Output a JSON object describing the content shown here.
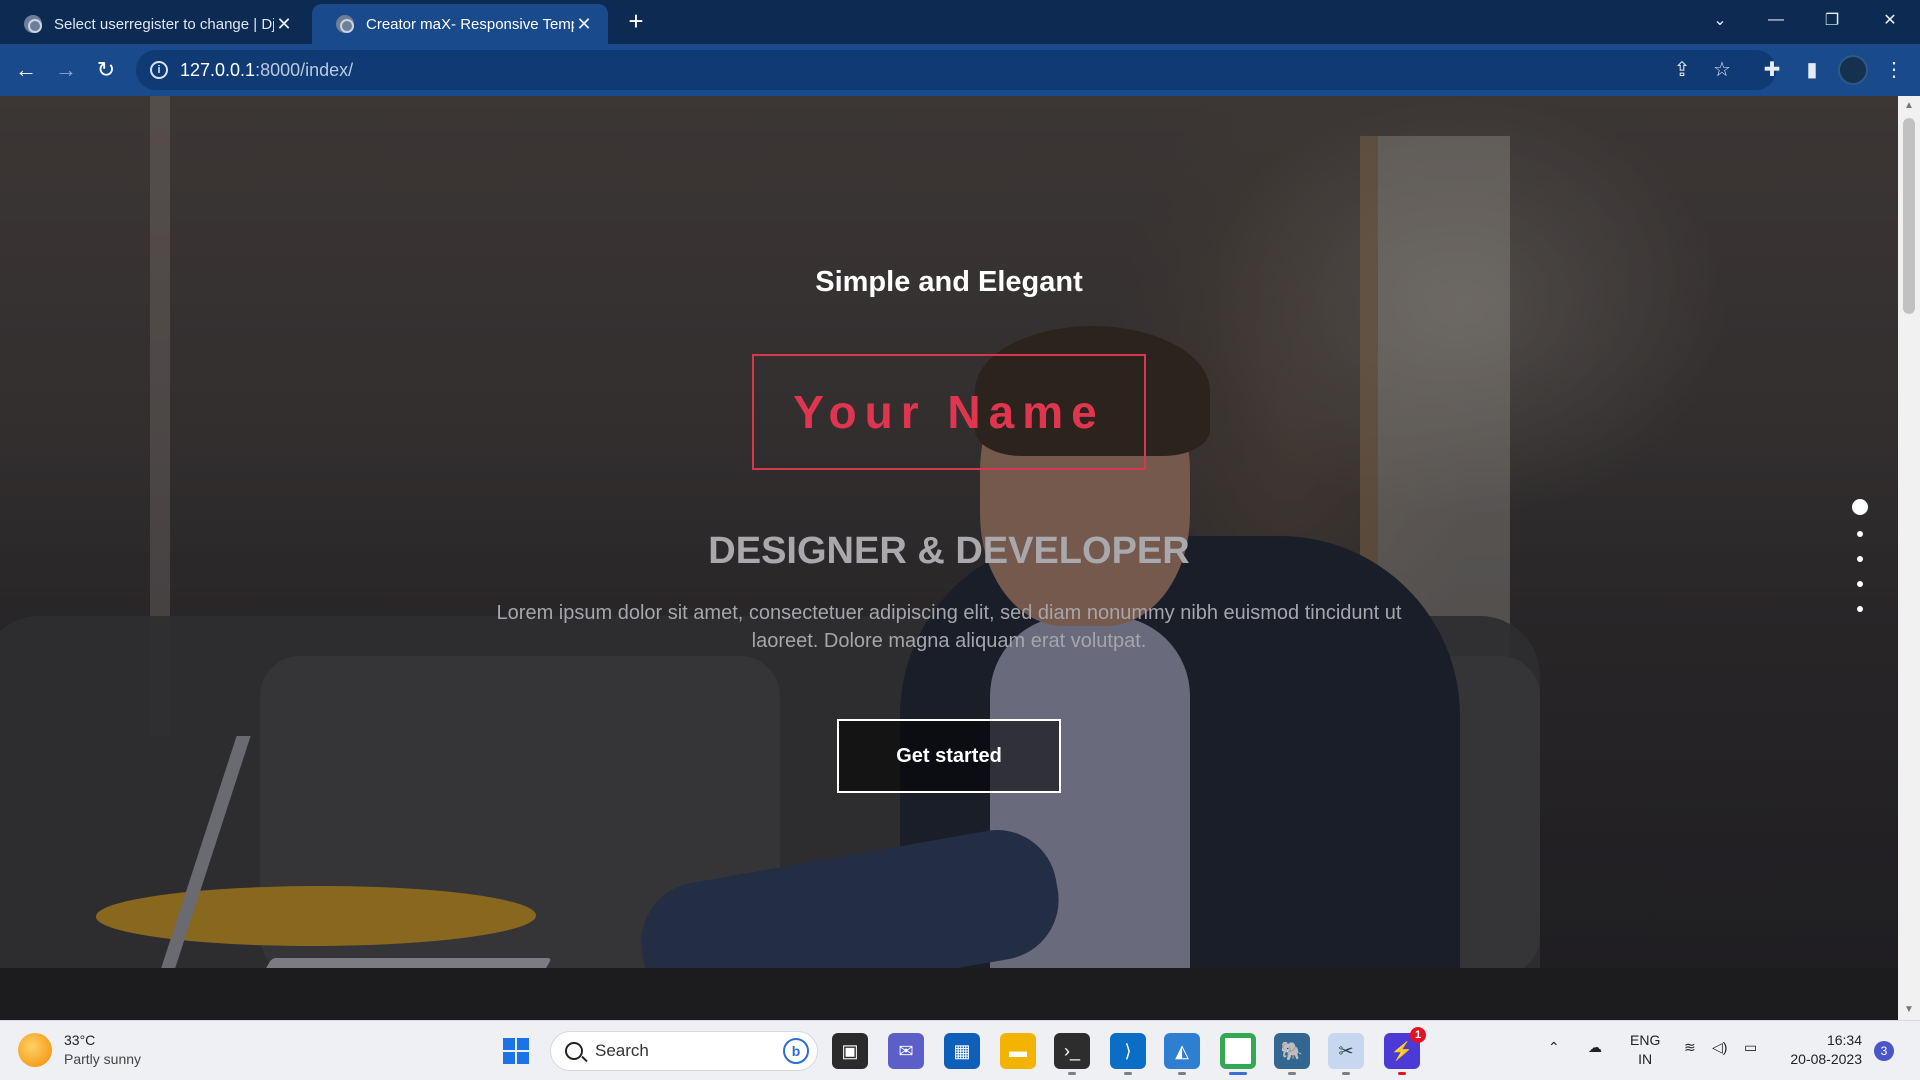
{
  "browser": {
    "tabs": [
      {
        "title": "Select userregister to change | Dj",
        "active": false
      },
      {
        "title": "Creator maX- Responsive Templa",
        "active": true
      }
    ],
    "new_tab_label": "+",
    "address": {
      "host": "127.0.0.1",
      "path": ":8000/index/"
    },
    "icons": {
      "back": "arrow-left-icon",
      "forward": "arrow-right-icon",
      "reload": "reload-icon",
      "info": "info-icon",
      "share": "share-icon",
      "bookmark": "star-icon",
      "extensions": "puzzle-icon",
      "sidepanel": "side-panel-icon",
      "menu": "kebab-menu-icon"
    }
  },
  "hero": {
    "tagline": "Simple and Elegant",
    "name": "Your Name",
    "role": "DESIGNER & DEVELOPER",
    "description": "Lorem ipsum dolor sit amet, consectetuer adipiscing elit, sed diam nonummy nibh euismod tincidunt ut laoreet. Dolore magna aliquam erat volutpat.",
    "cta_label": "Get started",
    "accent_color": "#e0354f",
    "slide_count": 5,
    "active_slide": 1
  },
  "taskbar": {
    "weather": {
      "temp": "33°C",
      "condition": "Partly sunny"
    },
    "search_label": "Search",
    "language": {
      "line1": "ENG",
      "line2": "IN"
    },
    "clock": {
      "time": "16:34",
      "date": "20-08-2023"
    },
    "notification_count": "3",
    "app_badge": "1"
  }
}
